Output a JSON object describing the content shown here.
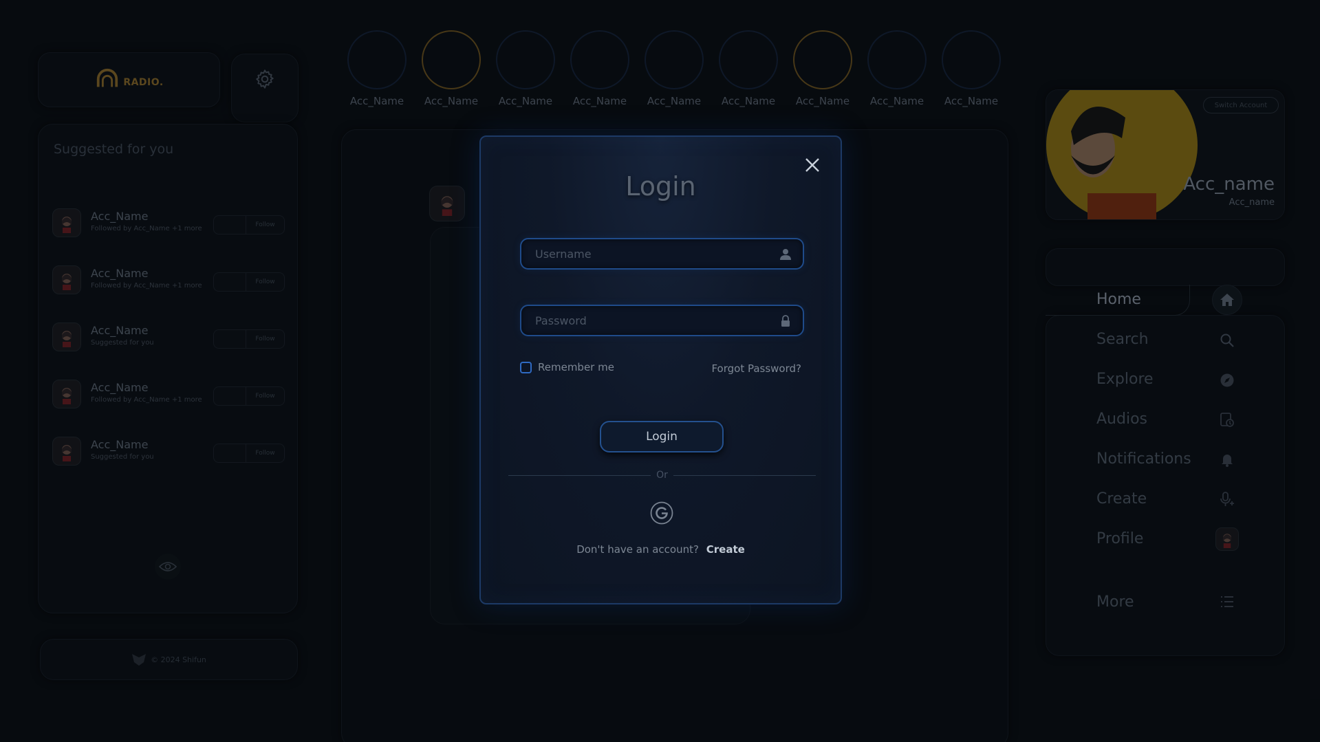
{
  "brand": {
    "logo_text": "RADIO."
  },
  "suggestions": {
    "title": "Suggested for you",
    "items": [
      {
        "name": "Acc_Name",
        "subtitle": "Followed by Acc_Name +1 more",
        "button": "Follow"
      },
      {
        "name": "Acc_Name",
        "subtitle": "Followed by Acc_Name +1 more",
        "button": "Follow"
      },
      {
        "name": "Acc_Name",
        "subtitle": "Suggested for you",
        "button": "Follow"
      },
      {
        "name": "Acc_Name",
        "subtitle": "Followed by Acc_Name +1 more",
        "button": "Follow"
      },
      {
        "name": "Acc_Name",
        "subtitle": "Suggested for you",
        "button": "Follow"
      }
    ]
  },
  "footer": {
    "text": "© 2024 Shifun"
  },
  "stories": [
    {
      "name": "Acc_Name",
      "active": false
    },
    {
      "name": "Acc_Name",
      "active": true
    },
    {
      "name": "Acc_Name",
      "active": false
    },
    {
      "name": "Acc_Name",
      "active": false
    },
    {
      "name": "Acc_Name",
      "active": false
    },
    {
      "name": "Acc_Name",
      "active": false
    },
    {
      "name": "Acc_Name",
      "active": true
    },
    {
      "name": "Acc_Name",
      "active": false
    },
    {
      "name": "Acc_Name",
      "active": false
    }
  ],
  "profile": {
    "name": "Acc_name",
    "handle": "Acc_name",
    "switch_label": "Switch Account"
  },
  "nav": {
    "home": "Home",
    "search": "Search",
    "explore": "Explore",
    "audios": "Audios",
    "notifications": "Notifications",
    "create": "Create",
    "profile": "Profile",
    "more": "More"
  },
  "login_modal": {
    "title": "Login",
    "username_placeholder": "Username",
    "password_placeholder": "Password",
    "remember_label": "Remember me",
    "forgot_label": "Forgot Password?",
    "submit_label": "Login",
    "or_label": "Or",
    "signup_prompt": "Don't have an account?",
    "signup_link": "Create"
  },
  "colors": {
    "background": "#0a0e13",
    "modal_border": "#1d3a66",
    "field_border": "#1f4b8a",
    "story_active_ring": "#6e5420",
    "profile_accent": "#c9a321"
  }
}
